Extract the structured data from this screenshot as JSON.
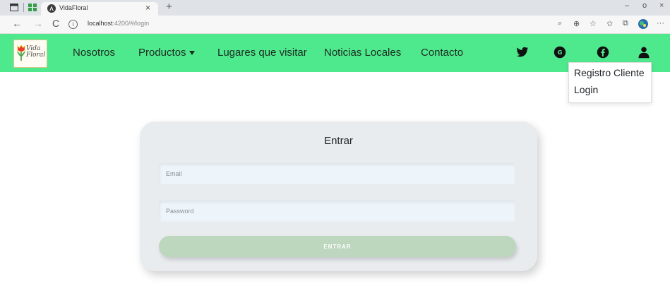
{
  "browser": {
    "tab_title": "VidaFloral",
    "tab_close": "×",
    "new_tab": "+",
    "url_host": "localhost",
    "url_rest": ":4200/#/login",
    "nav_back": "←",
    "nav_forward": "→",
    "nav_reload": "C",
    "win_minimize": "–",
    "win_restore": "o",
    "win_close": "×",
    "tools": {
      "search": "⌕",
      "zoom": "⊕",
      "read": "☆",
      "favorites": "✩",
      "collections": "⧉",
      "more": "···"
    }
  },
  "site": {
    "logo_text_1": "Vida",
    "logo_text_2": "Floral",
    "nav": {
      "nosotros": "Nosotros",
      "productos": "Productos",
      "lugares": "Lugares que visitar",
      "noticias": "Noticias Locales",
      "contacto": "Contacto"
    },
    "brand_color": "#4fe98d",
    "social_icons": [
      "twitter-icon",
      "google-plus-icon",
      "facebook-icon",
      "user-icon"
    ],
    "dropdown": {
      "registro": "Registro Cliente",
      "login": "Login"
    }
  },
  "login": {
    "title": "Entrar",
    "email_placeholder": "Email",
    "password_placeholder": "Password",
    "submit_label": "ENTRAR",
    "submit_color": "#bcd7be"
  }
}
